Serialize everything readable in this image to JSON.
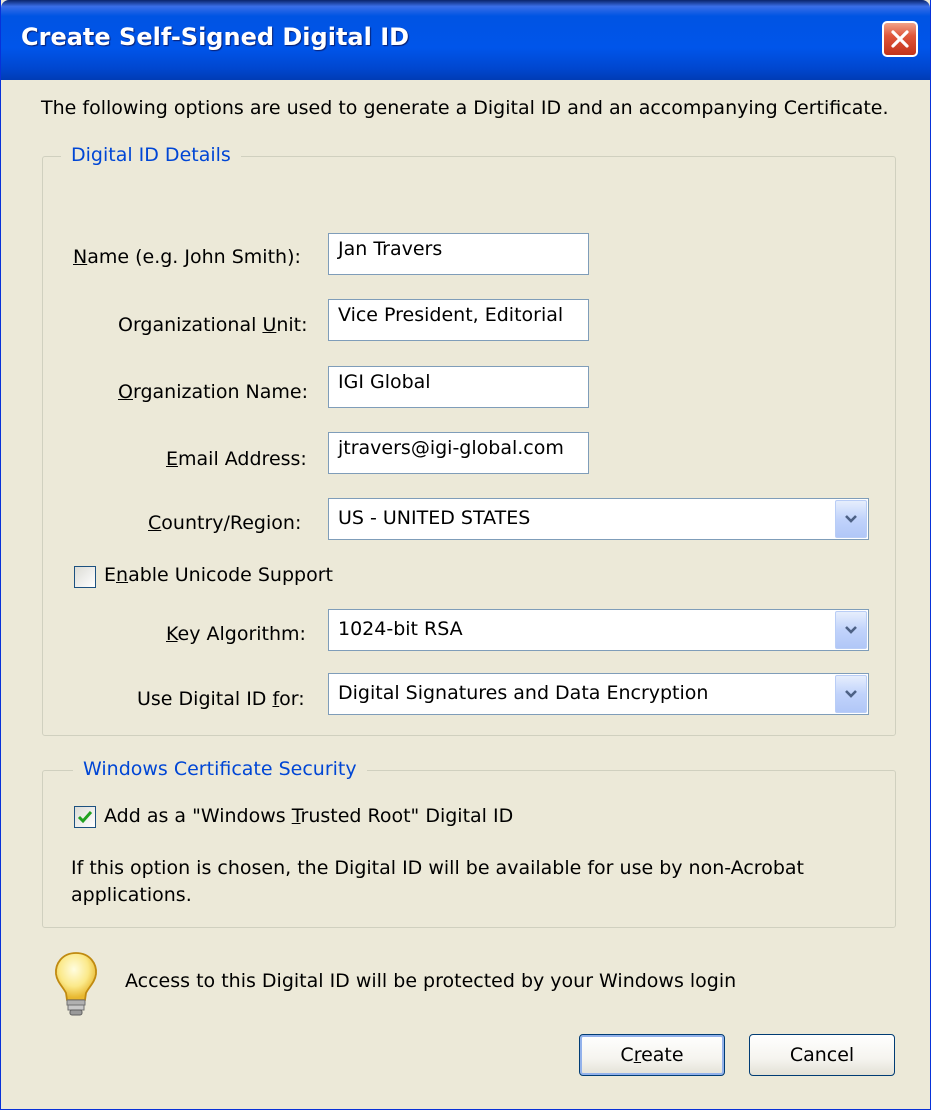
{
  "window": {
    "title": "Create Self-Signed Digital ID"
  },
  "intro": "The following options are used to generate a Digital ID and an accompanying Certificate.",
  "details_group": {
    "legend": "Digital ID Details",
    "name": {
      "label_pre": "",
      "label_key": "N",
      "label_post": "ame (e.g. John Smith):",
      "value": "Jan Travers"
    },
    "org_unit": {
      "label_pre": "Organizational ",
      "label_key": "U",
      "label_post": "nit:",
      "value": "Vice President, Editorial"
    },
    "org_name": {
      "label_pre": "",
      "label_key": "O",
      "label_post": "rganization Name:",
      "value": "IGI Global"
    },
    "email": {
      "label_pre": "",
      "label_key": "E",
      "label_post": "mail Address:",
      "value": "jtravers@igi-global.com"
    },
    "country": {
      "label_pre": "",
      "label_key": "C",
      "label_post": "ountry/Region:",
      "value": "US - UNITED STATES"
    },
    "unicode": {
      "label_pre": "E",
      "label_key": "n",
      "label_post": "able Unicode Support",
      "checked": false
    },
    "key_algorithm": {
      "label_pre": "",
      "label_key": "K",
      "label_post": "ey Algorithm:",
      "value": "1024-bit RSA"
    },
    "use_for": {
      "label_pre": "Use Digital ID ",
      "label_key": "f",
      "label_post": "or:",
      "value": "Digital Signatures and Data Encryption"
    }
  },
  "windows_group": {
    "legend": "Windows Certificate Security",
    "trusted_root": {
      "label_pre": "Add as a \"Windows ",
      "label_key": "T",
      "label_post": "rusted Root\" Digital ID",
      "checked": true
    },
    "note_line1": "If this option is chosen, the Digital ID will be available for use by non-Acrobat",
    "note_line2": "applications."
  },
  "hint": "Access to this Digital ID will be protected by your Windows login",
  "buttons": {
    "create": {
      "label_pre": "C",
      "label_key": "r",
      "label_post": "eate"
    },
    "cancel": "Cancel"
  },
  "colors": {
    "title_bar": "#0054e3",
    "dialog_bg": "#ece9d8",
    "legend_text": "#0046d5",
    "close_button": "#e0563b",
    "check_mark": "#21a121"
  },
  "icons": {
    "close": "close-icon",
    "dropdown": "chevron-down-icon",
    "check": "check-icon",
    "hint": "lightbulb-icon"
  }
}
